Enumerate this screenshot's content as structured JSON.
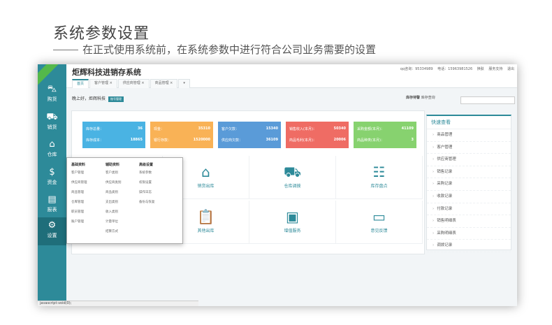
{
  "header": {
    "title": "系统参数设置",
    "subtitle": "在正式使用系统前，在系统参数中进行符合公司业务需要的设置"
  },
  "app": {
    "title": "炬辉科技进销存系统",
    "user_links": [
      "qq咨询：95334989",
      "电话：15963981526",
      "换肤",
      "服务支持",
      "退出"
    ],
    "tabs": [
      {
        "label": "首页",
        "active": true
      },
      {
        "label": "客户管理 ×"
      },
      {
        "label": "供应商管理 ×"
      },
      {
        "label": "商品管理 ×"
      },
      {
        "label": "▾"
      }
    ]
  },
  "sidebar": {
    "items": [
      {
        "label": "购货",
        "icon": "cart-icon"
      },
      {
        "label": "销货",
        "icon": "trolley-icon"
      },
      {
        "label": "仓库",
        "icon": "home-icon"
      },
      {
        "label": "资金",
        "icon": "dollar-icon"
      },
      {
        "label": "报表",
        "icon": "report-icon"
      },
      {
        "label": "设置",
        "icon": "gear-icon",
        "active": true
      }
    ]
  },
  "greeting": {
    "text": "晚上好，炬辉科技",
    "badge": "账号管理"
  },
  "search": {
    "label": "库存待警",
    "label2": "库存查询"
  },
  "stats": [
    {
      "color": "#4ab3e3",
      "r1": [
        "库存总量：",
        "36"
      ],
      "r2": [
        "库存成本：",
        "18865"
      ]
    },
    {
      "color": "#f9b256",
      "r1": [
        "现金：",
        "35310"
      ],
      "r2": [
        "银行存款：",
        "1520000"
      ]
    },
    {
      "color": "#5a9bd8",
      "r1": [
        "客户欠款：",
        "15340"
      ],
      "r2": [
        "供应商欠款：",
        "36109"
      ]
    },
    {
      "color": "#ef6c64",
      "r1": [
        "销售收入(本月)：",
        "50340"
      ],
      "r2": [
        "商品毛利(本月)：",
        "20006"
      ]
    },
    {
      "color": "#87d26f",
      "r1": [
        "采购金额(本月)：",
        "41109"
      ],
      "r2": [
        "商品种类(本月)：",
        "3"
      ]
    }
  ],
  "grid": [
    {
      "label": "",
      "icon": "",
      "row": 0,
      "col": 0
    },
    {
      "label": "销货出库",
      "icon": "house-icon",
      "row": 0,
      "col": 1
    },
    {
      "label": "仓库调拨",
      "icon": "truck-icon",
      "row": 0,
      "col": 2
    },
    {
      "label": "库存盘点",
      "icon": "checklist-icon",
      "row": 0,
      "col": 3
    },
    {
      "label": "",
      "icon": "",
      "row": 1,
      "col": 0
    },
    {
      "label": "其他出库",
      "icon": "clipboard-icon",
      "row": 1,
      "col": 1
    },
    {
      "label": "增值服务",
      "icon": "box-icon",
      "row": 1,
      "col": 2
    },
    {
      "label": "意见反馈",
      "icon": "monitor-icon",
      "row": 1,
      "col": 3
    }
  ],
  "quick": {
    "title": "快速查看",
    "items": [
      "商品管理",
      "客户管理",
      "供应商管理",
      "销售记录",
      "采购记录",
      "收款记录",
      "付款记录",
      "销售明细表",
      "采购明细表",
      "调拨记录"
    ]
  },
  "flyout": {
    "columns": [
      {
        "heading": "基础资料",
        "options": [
          "客户管理",
          "供应商管理",
          "商品管理",
          "仓库管理",
          "职员管理",
          "账户管理"
        ]
      },
      {
        "heading": "辅助资料",
        "options": [
          "客户类别",
          "供应商类别",
          "商品类别",
          "支出类别",
          "收入类别",
          "计量单位",
          "结算方式"
        ]
      },
      {
        "heading": "高级设置",
        "options": [
          "系统参数",
          "权限设置",
          "操作日志",
          "备份与恢复"
        ]
      }
    ]
  },
  "status": "javascript:void(0);"
}
